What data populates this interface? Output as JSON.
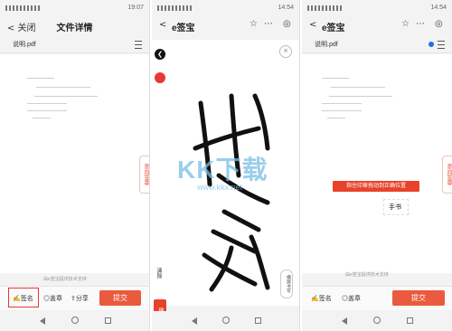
{
  "panel1": {
    "status_time": "19:07",
    "back_label": "< 关闭",
    "title": "文件详情",
    "filename": "说明.pdf",
    "side_tab": "意向签章",
    "tech_support": "由e签宝提供技术支持",
    "toolbar": {
      "sign": "签名",
      "seal": "盖章",
      "share": "分享",
      "submit": "提交"
    }
  },
  "panel2": {
    "status_time": "14:54",
    "back_label": "<",
    "title": "e签宝",
    "close_glyph": "×",
    "resign": "清除",
    "confirm": "确定",
    "landscape": "横屏书写"
  },
  "panel3": {
    "status_time": "14:54",
    "back_label": "<",
    "title": "e签宝",
    "filename": "说明.pdf",
    "side_tab": "意向签章",
    "tip": "指住印章拖动到正确位置",
    "signature_text": "手书",
    "tech_support": "由e签宝提供技术支持",
    "toolbar": {
      "sign": "签名",
      "seal": "盖章",
      "submit": "提交"
    }
  },
  "watermark": {
    "main": "KK下载",
    "sub": "www.kkx.net"
  },
  "colors": {
    "accent": "#e8432a",
    "highlight": "#e53935",
    "blue_dot": "#1a73e8"
  }
}
